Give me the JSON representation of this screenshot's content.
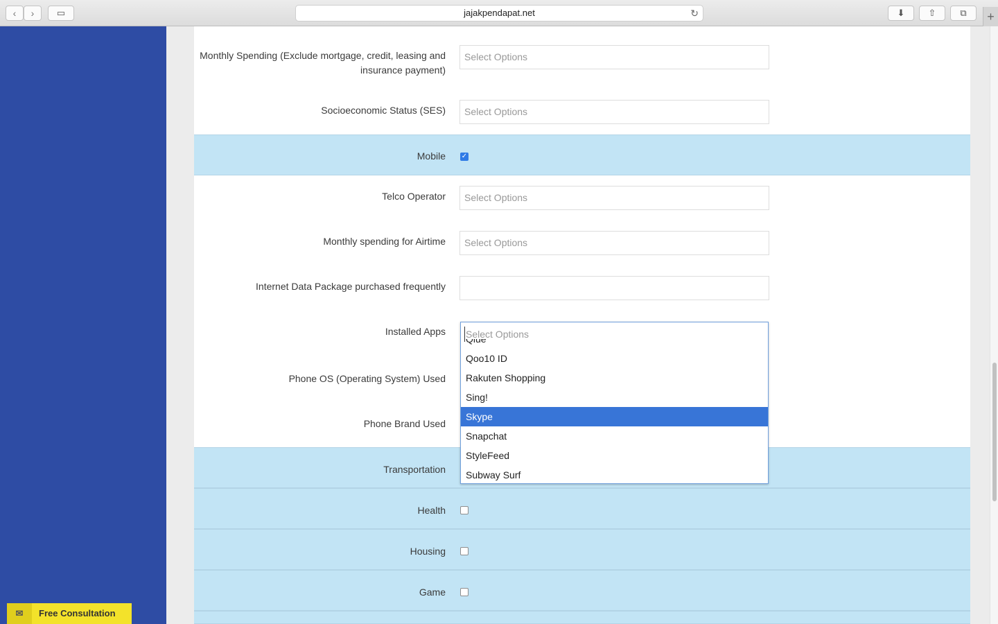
{
  "browser": {
    "url": "jajakpendapat.net",
    "back_glyph": "‹",
    "forward_glyph": "›",
    "sidebar_glyph": "▭",
    "reload_glyph": "↻",
    "download_glyph": "⬇",
    "share_glyph": "⇧",
    "tabs_glyph": "⧉",
    "new_tab_glyph": "+"
  },
  "form": {
    "monthly_spending": {
      "label": "Monthly Spending (Exclude mortgage, credit, leasing and insurance payment)",
      "placeholder": "Select Options"
    },
    "ses": {
      "label": "Socioeconomic Status (SES)",
      "placeholder": "Select Options"
    },
    "mobile": {
      "label": "Mobile",
      "checked": true
    },
    "telco": {
      "label": "Telco Operator",
      "placeholder": "Select Options"
    },
    "airtime": {
      "label": "Monthly spending for Airtime",
      "placeholder": "Select Options"
    },
    "data_package": {
      "label": "Internet Data Package purchased frequently",
      "placeholder": ""
    },
    "installed_apps": {
      "label": "Installed Apps",
      "placeholder": "Select Options",
      "options": [
        "Qiue",
        "Qoo10 ID",
        "Rakuten Shopping",
        "Sing!",
        "Skype",
        "Snapchat",
        "StyleFeed",
        "Subway Surf"
      ],
      "selected": "Skype"
    },
    "phone_os": {
      "label": "Phone OS (Operating System) Used"
    },
    "phone_brand": {
      "label": "Phone Brand Used"
    },
    "transportation": {
      "label": "Transportation"
    },
    "health": {
      "label": "Health"
    },
    "housing": {
      "label": "Housing"
    },
    "game": {
      "label": "Game"
    }
  },
  "consultation": {
    "label": "Free Consultation",
    "icon": "envelope-icon",
    "icon_glyph": "✉"
  },
  "colors": {
    "sidebar": "#2e4ca4",
    "band": "#c2e4f5",
    "selected": "#3875d7",
    "consult": "#f3e22a"
  }
}
